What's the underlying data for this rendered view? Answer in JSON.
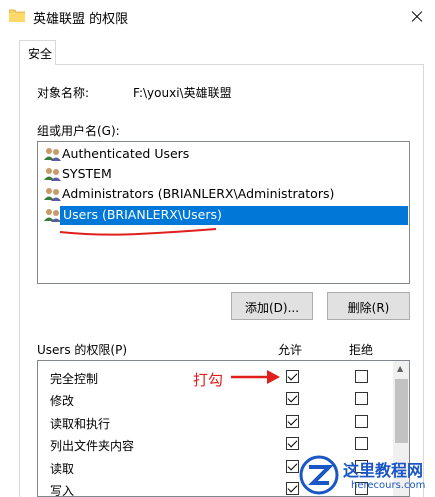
{
  "window": {
    "title": "英雄联盟 的权限"
  },
  "tabs": [
    {
      "label": "安全"
    }
  ],
  "object": {
    "label": "对象名称:",
    "value": "F:\\youxi\\英雄联盟"
  },
  "groups": {
    "label": "组或用户名(G):",
    "items": [
      {
        "label": "Authenticated Users",
        "selected": false
      },
      {
        "label": "SYSTEM",
        "selected": false
      },
      {
        "label": "Administrators (BRIANLERX\\Administrators)",
        "selected": false
      },
      {
        "label": "Users (BRIANLERX\\Users)",
        "selected": true
      }
    ]
  },
  "buttons": {
    "add": "添加(D)...",
    "remove": "删除(R)"
  },
  "permissions": {
    "title": "Users 的权限(P)",
    "allow_header": "允许",
    "deny_header": "拒绝",
    "rows": [
      {
        "name": "完全控制",
        "allow": true,
        "deny": false
      },
      {
        "name": "修改",
        "allow": true,
        "deny": false
      },
      {
        "name": "读取和执行",
        "allow": true,
        "deny": false
      },
      {
        "name": "列出文件夹内容",
        "allow": true,
        "deny": false
      },
      {
        "name": "读取",
        "allow": true,
        "deny": false
      },
      {
        "name": "写入",
        "allow": true,
        "deny": false
      }
    ]
  },
  "annotation": {
    "text": "打勾",
    "color": "#e0201c"
  },
  "watermark": {
    "title": "这里教程网",
    "url": "herecours.com"
  },
  "colors": {
    "selection": "#0078d7",
    "brand": "#1a57c4"
  },
  "icons": {
    "folder": "folder-icon",
    "close": "close-icon",
    "users": "user-group-icon"
  }
}
